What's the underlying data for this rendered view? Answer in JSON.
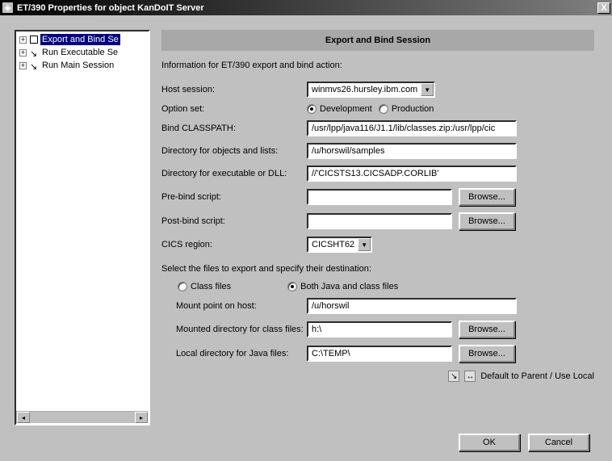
{
  "window": {
    "title": "ET/390 Properties for object KanDoIT Server",
    "close": "X"
  },
  "tree": {
    "items": [
      {
        "label": "Export and Bind Se",
        "selected": true
      },
      {
        "label": "Run Executable Se",
        "selected": false
      },
      {
        "label": "Run Main Session",
        "selected": false
      }
    ]
  },
  "header": {
    "title": "Export and Bind Session"
  },
  "info": "Information for ET/390 export and bind action:",
  "fields": {
    "host_session_label": "Host session:",
    "host_session_value": "winmvs26.hursley.ibm.com",
    "option_set_label": "Option set:",
    "option_dev": "Development",
    "option_prod": "Production",
    "bind_classpath_label": "Bind CLASSPATH:",
    "bind_classpath_value": "/usr/lpp/java116/J1.1/lib/classes.zip:/usr/lpp/cic",
    "dir_objects_label": "Directory for objects and lists:",
    "dir_objects_value": "/u/horswil/samples",
    "dir_exec_label": "Directory for executable or DLL:",
    "dir_exec_value": "//'CICSTS13.CICSADP.CORLIB'",
    "pre_bind_label": "Pre-bind script:",
    "pre_bind_value": "",
    "post_bind_label": "Post-bind script:",
    "post_bind_value": "",
    "cics_region_label": "CICS region:",
    "cics_region_value": "CICSHT62"
  },
  "files_section": {
    "prompt": "Select the files to export and specify their destination:",
    "class_files": "Class files",
    "both_files": "Both Java and class files",
    "mount_point_label": "Mount point on host:",
    "mount_point_value": "/u/horswil",
    "mounted_dir_label": "Mounted directory for class files:",
    "mounted_dir_value": "h:\\",
    "local_dir_label": "Local directory for Java files:",
    "local_dir_value": "C:\\TEMP\\"
  },
  "buttons": {
    "browse": "Browse...",
    "ok": "OK",
    "cancel": "Cancel"
  },
  "default_line": "Default to Parent / Use Local"
}
